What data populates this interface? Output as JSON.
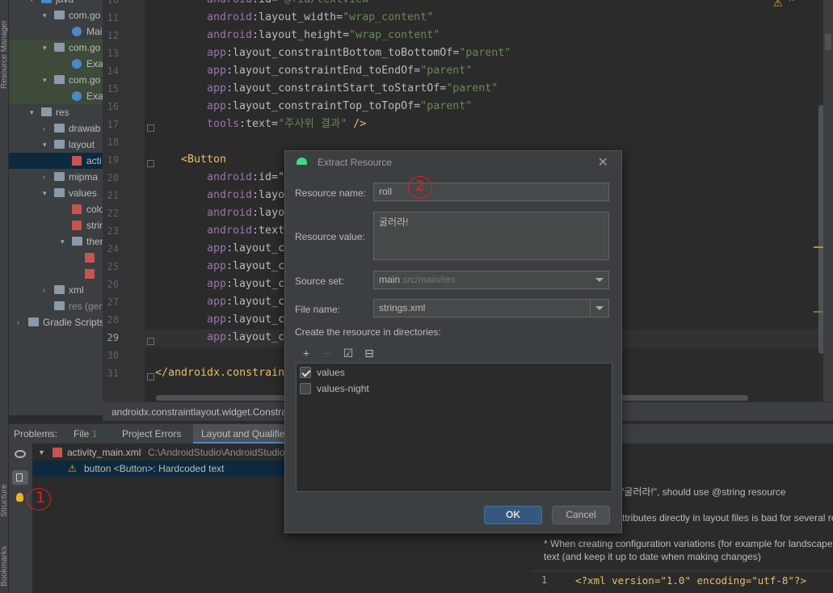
{
  "tool_windows": {
    "resource_manager": "Resource Manager",
    "structure": "Structure",
    "bookmarks": "Bookmarks"
  },
  "tree": [
    {
      "label": "java",
      "type": "folder-blue",
      "arrow": "▾",
      "indent": 1
    },
    {
      "label": "com.go",
      "type": "folder",
      "arrow": "▾",
      "indent": 2
    },
    {
      "label": "Mai",
      "type": "kotlin",
      "arrow": "",
      "indent": 3
    },
    {
      "label": "com.go",
      "type": "folder",
      "arrow": "▾",
      "indent": 2,
      "highlight": true
    },
    {
      "label": "Exa",
      "type": "kotlin",
      "arrow": "",
      "indent": 3,
      "highlight": true
    },
    {
      "label": "com.go",
      "type": "folder",
      "arrow": "▾",
      "indent": 2,
      "highlight": true
    },
    {
      "label": "Exa",
      "type": "kotlin",
      "arrow": "",
      "indent": 3,
      "highlight": true
    },
    {
      "label": "res",
      "type": "folder",
      "arrow": "▾",
      "indent": 1
    },
    {
      "label": "drawab",
      "type": "folder",
      "arrow": "›",
      "indent": 2
    },
    {
      "label": "layout",
      "type": "folder",
      "arrow": "▾",
      "indent": 2
    },
    {
      "label": "acti",
      "type": "xml",
      "arrow": "",
      "indent": 3,
      "selected": true
    },
    {
      "label": "mipma",
      "type": "folder",
      "arrow": "›",
      "indent": 2
    },
    {
      "label": "values",
      "type": "folder",
      "arrow": "▾",
      "indent": 2
    },
    {
      "label": "colo",
      "type": "xml",
      "arrow": "",
      "indent": 3
    },
    {
      "label": "strin",
      "type": "xml",
      "arrow": "",
      "indent": 3
    },
    {
      "label": "ther",
      "type": "folder",
      "arrow": "▾",
      "indent": 3
    },
    {
      "label": "",
      "type": "xml",
      "arrow": "",
      "indent": 4
    },
    {
      "label": "",
      "type": "xml",
      "arrow": "",
      "indent": 4
    },
    {
      "label": "xml",
      "type": "folder",
      "arrow": "›",
      "indent": 2
    },
    {
      "label": "res (genera",
      "type": "folder",
      "arrow": "",
      "indent": 2,
      "dim": true
    },
    {
      "label": "Gradle Scripts",
      "type": "gradle",
      "arrow": "›",
      "indent": 0
    }
  ],
  "code": [
    {
      "n": "10",
      "parts": [
        [
          "ns",
          "android"
        ],
        [
          "attr",
          ":id="
        ],
        [
          "val",
          "\"@+id/textView\""
        ]
      ],
      "indent": 1
    },
    {
      "n": "11",
      "parts": [
        [
          "ns",
          "android"
        ],
        [
          "attr",
          ":layout_width="
        ],
        [
          "val",
          "\"wrap_content\""
        ]
      ],
      "indent": 1
    },
    {
      "n": "12",
      "parts": [
        [
          "ns",
          "android"
        ],
        [
          "attr",
          ":layout_height="
        ],
        [
          "val",
          "\"wrap_content\""
        ]
      ],
      "indent": 1
    },
    {
      "n": "13",
      "parts": [
        [
          "ns",
          "app"
        ],
        [
          "attr",
          ":layout_constraintBottom_toBottomOf="
        ],
        [
          "val",
          "\"parent\""
        ]
      ],
      "indent": 1
    },
    {
      "n": "14",
      "parts": [
        [
          "ns",
          "app"
        ],
        [
          "attr",
          ":layout_constraintEnd_toEndOf="
        ],
        [
          "val",
          "\"parent\""
        ]
      ],
      "indent": 1
    },
    {
      "n": "15",
      "parts": [
        [
          "ns",
          "app"
        ],
        [
          "attr",
          ":layout_constraintStart_toStartOf="
        ],
        [
          "val",
          "\"parent\""
        ]
      ],
      "indent": 1
    },
    {
      "n": "16",
      "parts": [
        [
          "ns",
          "app"
        ],
        [
          "attr",
          ":layout_constraintTop_toTopOf="
        ],
        [
          "val",
          "\"parent\""
        ]
      ],
      "indent": 1
    },
    {
      "n": "17",
      "parts": [
        [
          "ns",
          "tools"
        ],
        [
          "attr",
          ":text="
        ],
        [
          "val",
          "\"주사위 결과\""
        ],
        [
          "tag",
          " />"
        ]
      ],
      "indent": 1
    },
    {
      "n": "18",
      "parts": [],
      "indent": 0
    },
    {
      "n": "19",
      "parts": [
        [
          "tag",
          "<Button"
        ]
      ],
      "indent": 0
    },
    {
      "n": "20",
      "parts": [
        [
          "ns",
          "android"
        ],
        [
          "attr",
          ":id=\""
        ]
      ],
      "indent": 1
    },
    {
      "n": "21",
      "parts": [
        [
          "ns",
          "android"
        ],
        [
          "attr",
          ":layo"
        ]
      ],
      "indent": 1
    },
    {
      "n": "22",
      "parts": [
        [
          "ns",
          "android"
        ],
        [
          "attr",
          ":layo"
        ]
      ],
      "indent": 1
    },
    {
      "n": "23",
      "parts": [
        [
          "ns",
          "android"
        ],
        [
          "attr",
          ":text"
        ]
      ],
      "indent": 1
    },
    {
      "n": "24",
      "parts": [
        [
          "ns",
          "app"
        ],
        [
          "attr",
          ":layout_c"
        ]
      ],
      "indent": 1
    },
    {
      "n": "25",
      "parts": [
        [
          "ns",
          "app"
        ],
        [
          "attr",
          ":layout_c"
        ]
      ],
      "indent": 1
    },
    {
      "n": "26",
      "parts": [
        [
          "ns",
          "app"
        ],
        [
          "attr",
          ":layout_c"
        ]
      ],
      "indent": 1
    },
    {
      "n": "27",
      "parts": [
        [
          "ns",
          "app"
        ],
        [
          "attr",
          ":layout_c"
        ]
      ],
      "indent": 1
    },
    {
      "n": "28",
      "parts": [
        [
          "ns",
          "app"
        ],
        [
          "attr",
          ":layout_c"
        ]
      ],
      "indent": 1
    },
    {
      "n": "29",
      "parts": [
        [
          "ns",
          "app"
        ],
        [
          "attr",
          ":layout_c"
        ]
      ],
      "indent": 1,
      "current": true
    },
    {
      "n": "30",
      "parts": [],
      "indent": 0
    },
    {
      "n": "31",
      "parts": [
        [
          "tag",
          "</androidx.constrain"
        ]
      ],
      "indent": -1
    }
  ],
  "breadcrumb": "androidx.constraintlayout.widget.Constra",
  "problems": {
    "label": "Problems:",
    "tabs": [
      {
        "label": "File",
        "count": "1"
      },
      {
        "label": "Project Errors",
        "count": ""
      },
      {
        "label": "Layout and Qualifie",
        "count": "",
        "active": true
      }
    ],
    "file_row": {
      "name": "activity_main.xml",
      "path": "C:\\AndroidStudio\\AndroidStudio"
    },
    "issue_row": "button <Button>: Hardcoded text"
  },
  "detail": {
    "line1": "'굴러라!\", should use @string resource",
    "line2": "ttributes directly in layout files is bad for several re",
    "line3": "* When creating configuration variations (for example for landscape",
    "line4": "text (and keep it up to date when making changes)",
    "mini_ln": "1",
    "mini_code": "<?xml version=\"1.0\" encoding=\"utf-8\"?>"
  },
  "dialog": {
    "title": "Extract Resource",
    "resource_name_label": "Resource name:",
    "resource_name_value": "roll",
    "resource_value_label": "Resource value:",
    "resource_value_value": "굴러라!",
    "source_set_label": "Source set:",
    "source_set_value": "main",
    "source_set_hint": "src/main/res",
    "file_name_label": "File name:",
    "file_name_value": "strings.xml",
    "dirs_label": "Create the resource in directories:",
    "dirs": [
      {
        "label": "values",
        "checked": true
      },
      {
        "label": "values-night",
        "checked": false
      }
    ],
    "ok_label": "OK",
    "cancel_label": "Cancel"
  },
  "annotations": {
    "one": "1",
    "two": "2"
  },
  "colors": {
    "accent": "#4a88c7",
    "ok_button": "#365880",
    "annotation": "#e02020"
  }
}
